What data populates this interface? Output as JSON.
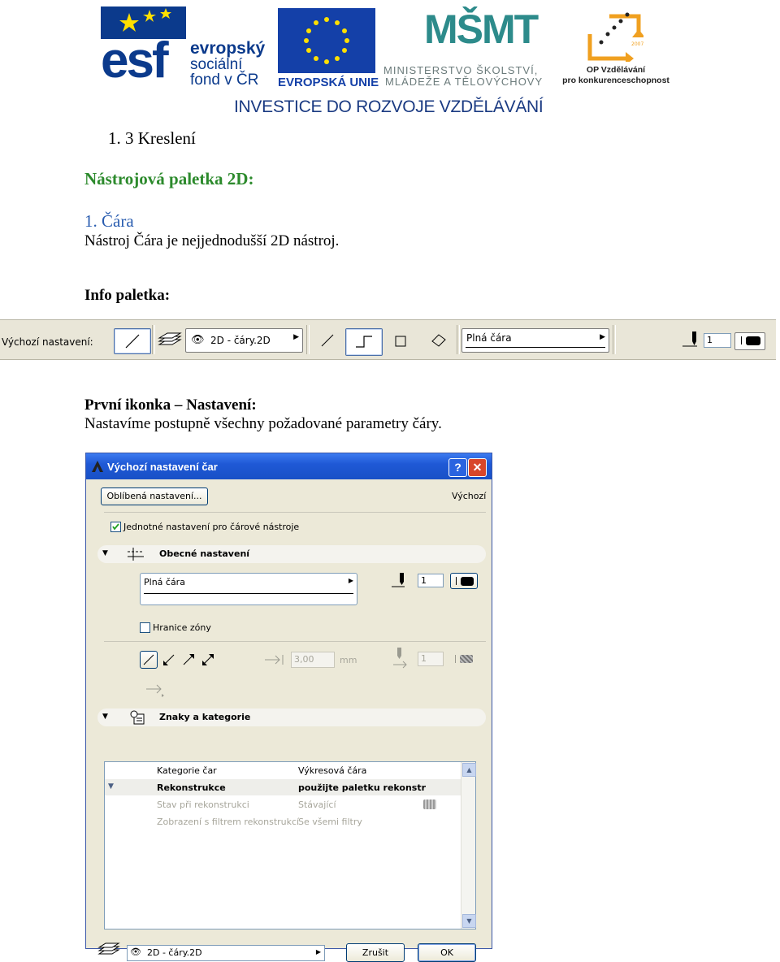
{
  "header": {
    "esf": {
      "letters": "esf",
      "line1": "evropský",
      "line2": "sociální",
      "line3": "fond v ČR"
    },
    "eu": {
      "text": "EVROPSKÁ UNIE"
    },
    "msmt": {
      "mark": "MŠMT",
      "line1": "MINISTERSTVO ŠKOLSTVÍ,",
      "line2": "MLÁDEŽE A TĚLOVÝCHOVY"
    },
    "op": {
      "line1": "OP Vzdělávání",
      "line2": "pro konkurenceschopnost",
      "years": "2007-13"
    },
    "investice": "INVESTICE DO ROZVOJE VZDĚLÁVÁNÍ",
    "colors": {
      "esf_blue": "#0b3a8c",
      "eu_blue": "#1440a8",
      "msmt_teal": "#2d8b8b",
      "op_orange": "#f0a020"
    }
  },
  "document": {
    "section_title": "1.  3 Kreslení",
    "subtitle": "Nástrojová paletka 2D:",
    "item_title": "1. Čára",
    "item_text": "Nástroj Čára je nejjednodušší 2D nástroj.",
    "info_heading": "Info paletka:",
    "first_icon_heading": "První ikonka – Nastavení:",
    "first_icon_text": "Nastavíme postupně všechny požadované parametry čáry.",
    "colors": {
      "green": "#2c8a2c",
      "blue": "#2a5db0"
    }
  },
  "toolbar": {
    "label": "Výchozí nastavení:",
    "layer_dropdown": "2D - čáry.2D",
    "line_type_dropdown": "Plná čára",
    "pen_value": "1",
    "icons": [
      "line-tool-icon",
      "layers-icon",
      "eye-icon",
      "single-line-icon",
      "polyline-icon",
      "rectangle-icon",
      "rotated-rectangle-icon",
      "pen-icon"
    ]
  },
  "dialog": {
    "title": "Výchozí nastavení čar",
    "help_button": "?",
    "close_button": "✕",
    "favorites_button": "Oblíbená nastavení...",
    "default_label": "Výchozí",
    "uniform_settings_label": "Jednotné nastavení pro čárové nástroje",
    "uniform_settings_checked": true,
    "general_panel": "Obecné nastavení",
    "line_type": "Plná čára",
    "pen_value": "1",
    "zone_boundary_label": "Hranice zóny",
    "zone_boundary_checked": false,
    "arrow_size": "3,00",
    "arrow_unit": "mm",
    "arrow_pen": "1",
    "symbols_panel": "Znaky a kategorie",
    "list_rows": [
      {
        "name": "Kategorie čar",
        "value": "Výkresová čára",
        "style": "normal"
      },
      {
        "name": "Rekonstrukce",
        "value": "použijte paletku rekonstr",
        "style": "bold"
      },
      {
        "name": "Stav při rekonstrukci",
        "value": "Stávající",
        "style": "grey"
      },
      {
        "name": "Zobrazení s filtrem rekonstrukcí",
        "value": "Se všemi filtry",
        "style": "grey"
      }
    ],
    "layer_dropdown": "2D - čáry.2D",
    "cancel_button": "Zrušit",
    "ok_button": "OK",
    "colors": {
      "title_blue": "#1f59d6",
      "face": "#ece9d8"
    }
  }
}
